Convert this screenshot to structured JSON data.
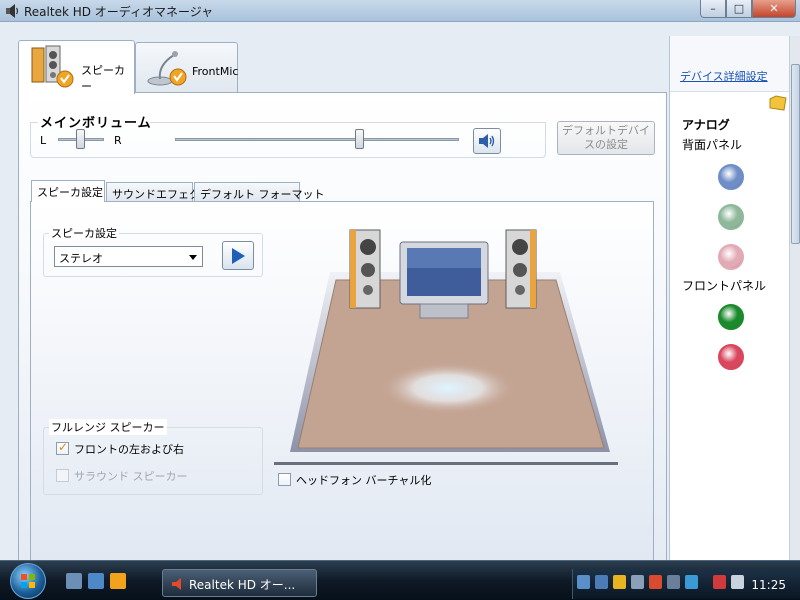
{
  "window": {
    "title": "Realtek HD オーディオマネージャ",
    "minimize_glyph": "–",
    "maximize_glyph": "□",
    "close_glyph": "✕"
  },
  "device_tabs": [
    {
      "label": "スピーカー",
      "icon": "speaker-device-icon",
      "active": true
    },
    {
      "label": "FrontMic",
      "icon": "microphone-device-icon",
      "active": false
    }
  ],
  "main_volume": {
    "title": "メインボリューム",
    "left_label": "L",
    "right_label": "R",
    "balance_fraction": 0.5,
    "volume_fraction": 0.65,
    "mute_icon": "speaker-volume-icon"
  },
  "default_device_button": "デフォルトデバイスの設定",
  "sub_tabs": [
    {
      "label": "スピーカ設定",
      "active": true
    },
    {
      "label": "サウンドエフェクト",
      "active": false
    },
    {
      "label": "デフォルト フォーマット",
      "active": false
    }
  ],
  "speaker_config": {
    "group_title": "スピーカ設定",
    "selected_value": "ステレオ",
    "play_icon": "play-icon"
  },
  "full_range": {
    "group_title": "フルレンジ スピーカー",
    "front_label": "フロントの左および右",
    "front_checked": true,
    "surround_label": "サラウンド スピーカー",
    "surround_checked": false,
    "surround_enabled": false
  },
  "headphone_virtualization": {
    "label": "ヘッドフォン バーチャル化",
    "checked": false
  },
  "right_panel": {
    "advanced_link": "デバイス詳細設定",
    "analog_title": "アナログ",
    "rear_panel_label": "背面パネル",
    "front_panel_label": "フロントパネル",
    "rear_jacks": [
      {
        "color": "#6f8ec7",
        "name": "blue-jack"
      },
      {
        "color": "#8fb89a",
        "name": "green-jack"
      },
      {
        "color": "#e2aab5",
        "name": "pink-jack"
      }
    ],
    "front_jacks": [
      {
        "color": "#1b8a2c",
        "name": "green-jack"
      },
      {
        "color": "#d9475e",
        "name": "red-jack"
      }
    ]
  },
  "taskbar": {
    "task_label": "Realtek HD オー...",
    "clock": "11:25"
  }
}
